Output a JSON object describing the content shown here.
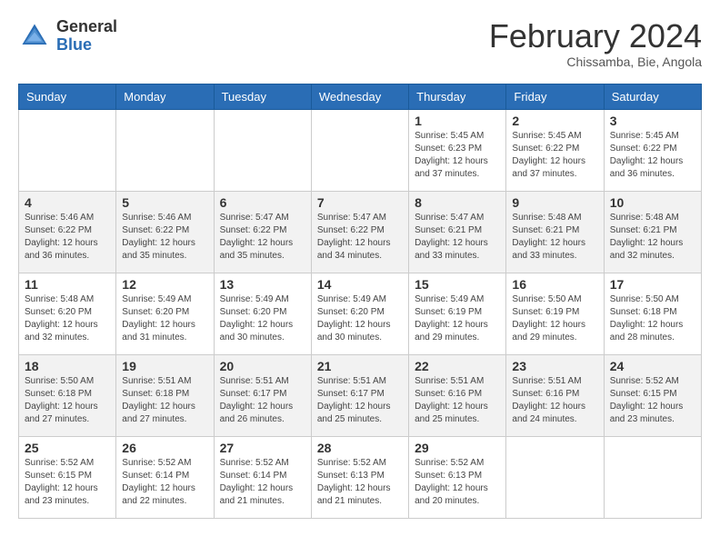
{
  "header": {
    "logo_general": "General",
    "logo_blue": "Blue",
    "month_title": "February 2024",
    "subtitle": "Chissamba, Bie, Angola"
  },
  "days_of_week": [
    "Sunday",
    "Monday",
    "Tuesday",
    "Wednesday",
    "Thursday",
    "Friday",
    "Saturday"
  ],
  "weeks": [
    [
      {
        "day": "",
        "info": ""
      },
      {
        "day": "",
        "info": ""
      },
      {
        "day": "",
        "info": ""
      },
      {
        "day": "",
        "info": ""
      },
      {
        "day": "1",
        "info": "Sunrise: 5:45 AM\nSunset: 6:23 PM\nDaylight: 12 hours and 37 minutes."
      },
      {
        "day": "2",
        "info": "Sunrise: 5:45 AM\nSunset: 6:22 PM\nDaylight: 12 hours and 37 minutes."
      },
      {
        "day": "3",
        "info": "Sunrise: 5:45 AM\nSunset: 6:22 PM\nDaylight: 12 hours and 36 minutes."
      }
    ],
    [
      {
        "day": "4",
        "info": "Sunrise: 5:46 AM\nSunset: 6:22 PM\nDaylight: 12 hours and 36 minutes."
      },
      {
        "day": "5",
        "info": "Sunrise: 5:46 AM\nSunset: 6:22 PM\nDaylight: 12 hours and 35 minutes."
      },
      {
        "day": "6",
        "info": "Sunrise: 5:47 AM\nSunset: 6:22 PM\nDaylight: 12 hours and 35 minutes."
      },
      {
        "day": "7",
        "info": "Sunrise: 5:47 AM\nSunset: 6:22 PM\nDaylight: 12 hours and 34 minutes."
      },
      {
        "day": "8",
        "info": "Sunrise: 5:47 AM\nSunset: 6:21 PM\nDaylight: 12 hours and 33 minutes."
      },
      {
        "day": "9",
        "info": "Sunrise: 5:48 AM\nSunset: 6:21 PM\nDaylight: 12 hours and 33 minutes."
      },
      {
        "day": "10",
        "info": "Sunrise: 5:48 AM\nSunset: 6:21 PM\nDaylight: 12 hours and 32 minutes."
      }
    ],
    [
      {
        "day": "11",
        "info": "Sunrise: 5:48 AM\nSunset: 6:20 PM\nDaylight: 12 hours and 32 minutes."
      },
      {
        "day": "12",
        "info": "Sunrise: 5:49 AM\nSunset: 6:20 PM\nDaylight: 12 hours and 31 minutes."
      },
      {
        "day": "13",
        "info": "Sunrise: 5:49 AM\nSunset: 6:20 PM\nDaylight: 12 hours and 30 minutes."
      },
      {
        "day": "14",
        "info": "Sunrise: 5:49 AM\nSunset: 6:20 PM\nDaylight: 12 hours and 30 minutes."
      },
      {
        "day": "15",
        "info": "Sunrise: 5:49 AM\nSunset: 6:19 PM\nDaylight: 12 hours and 29 minutes."
      },
      {
        "day": "16",
        "info": "Sunrise: 5:50 AM\nSunset: 6:19 PM\nDaylight: 12 hours and 29 minutes."
      },
      {
        "day": "17",
        "info": "Sunrise: 5:50 AM\nSunset: 6:18 PM\nDaylight: 12 hours and 28 minutes."
      }
    ],
    [
      {
        "day": "18",
        "info": "Sunrise: 5:50 AM\nSunset: 6:18 PM\nDaylight: 12 hours and 27 minutes."
      },
      {
        "day": "19",
        "info": "Sunrise: 5:51 AM\nSunset: 6:18 PM\nDaylight: 12 hours and 27 minutes."
      },
      {
        "day": "20",
        "info": "Sunrise: 5:51 AM\nSunset: 6:17 PM\nDaylight: 12 hours and 26 minutes."
      },
      {
        "day": "21",
        "info": "Sunrise: 5:51 AM\nSunset: 6:17 PM\nDaylight: 12 hours and 25 minutes."
      },
      {
        "day": "22",
        "info": "Sunrise: 5:51 AM\nSunset: 6:16 PM\nDaylight: 12 hours and 25 minutes."
      },
      {
        "day": "23",
        "info": "Sunrise: 5:51 AM\nSunset: 6:16 PM\nDaylight: 12 hours and 24 minutes."
      },
      {
        "day": "24",
        "info": "Sunrise: 5:52 AM\nSunset: 6:15 PM\nDaylight: 12 hours and 23 minutes."
      }
    ],
    [
      {
        "day": "25",
        "info": "Sunrise: 5:52 AM\nSunset: 6:15 PM\nDaylight: 12 hours and 23 minutes."
      },
      {
        "day": "26",
        "info": "Sunrise: 5:52 AM\nSunset: 6:14 PM\nDaylight: 12 hours and 22 minutes."
      },
      {
        "day": "27",
        "info": "Sunrise: 5:52 AM\nSunset: 6:14 PM\nDaylight: 12 hours and 21 minutes."
      },
      {
        "day": "28",
        "info": "Sunrise: 5:52 AM\nSunset: 6:13 PM\nDaylight: 12 hours and 21 minutes."
      },
      {
        "day": "29",
        "info": "Sunrise: 5:52 AM\nSunset: 6:13 PM\nDaylight: 12 hours and 20 minutes."
      },
      {
        "day": "",
        "info": ""
      },
      {
        "day": "",
        "info": ""
      }
    ]
  ]
}
